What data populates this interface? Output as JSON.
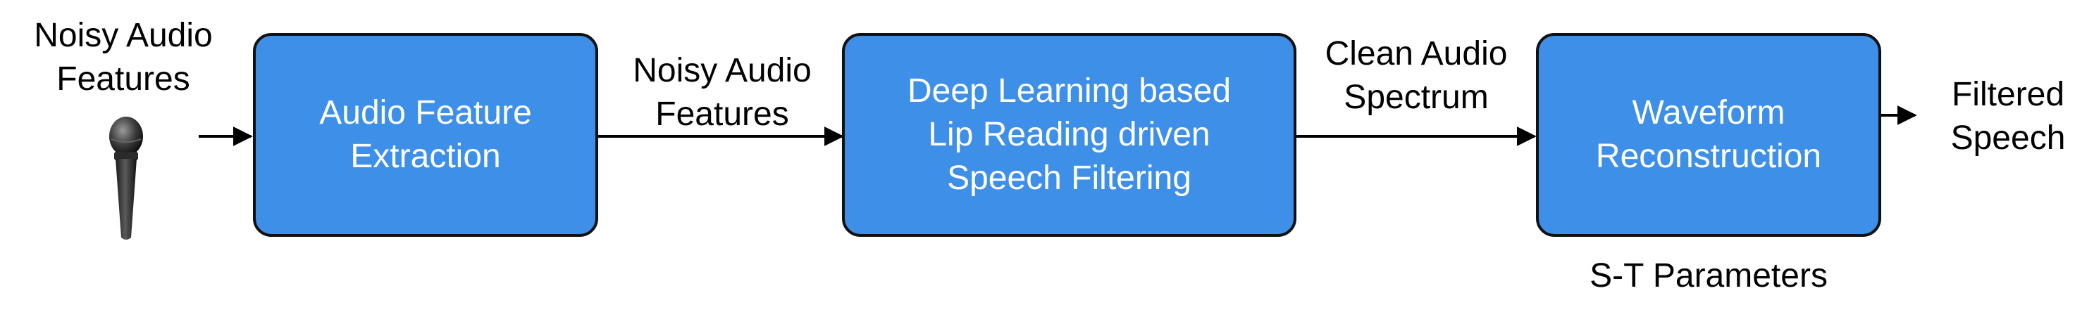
{
  "input": {
    "label_lines": [
      "Noisy Audio",
      "Features"
    ],
    "icon": "microphone-icon"
  },
  "boxes": [
    {
      "id": "extraction",
      "lines": [
        "Audio Feature",
        "Extraction"
      ]
    },
    {
      "id": "filtering",
      "lines": [
        "Deep Learning based",
        "Lip Reading driven",
        "Speech Filtering"
      ]
    },
    {
      "id": "reconstruction",
      "lines": [
        "Waveform",
        "Reconstruction"
      ]
    }
  ],
  "edge_labels": {
    "extraction_to_filtering": [
      "Noisy Audio",
      "Features"
    ],
    "filtering_to_reconstruction": [
      "Clean Audio",
      "Spectrum"
    ]
  },
  "output": {
    "label_lines": [
      "Filtered",
      "Speech"
    ]
  },
  "parameters_label": "S-T Parameters",
  "colors": {
    "box_fill": "#3d8fe8",
    "box_border": "#111111",
    "box_text": "#ffffff",
    "arrow": "#000000"
  }
}
